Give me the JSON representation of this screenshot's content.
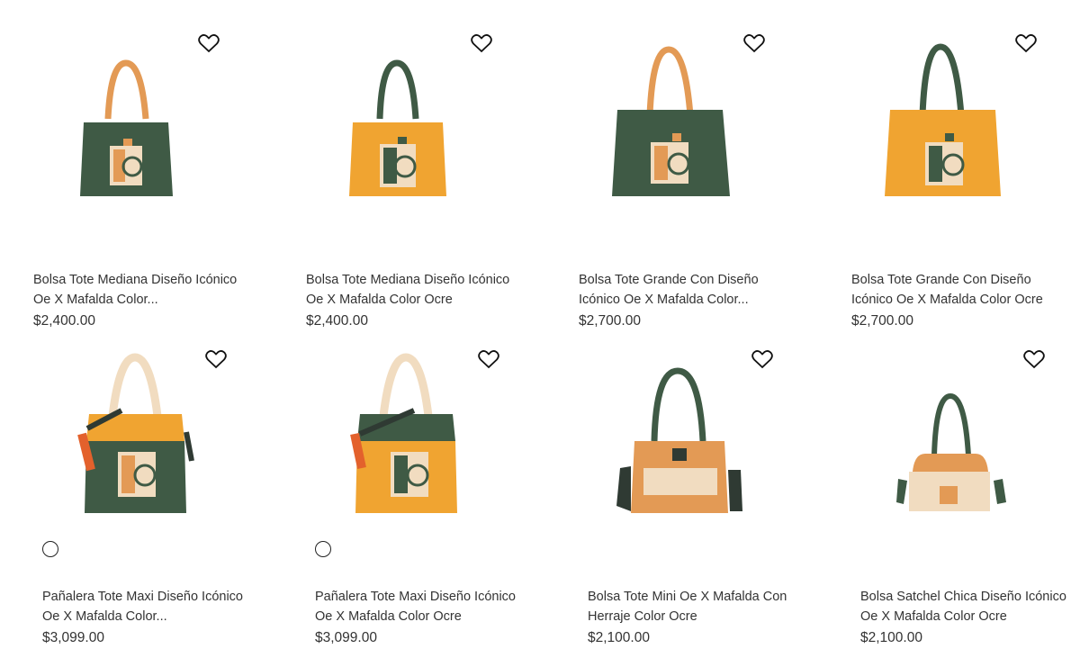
{
  "colors": {
    "green": "#3f5a45",
    "ochre": "#f0a431",
    "tan": "#e39a55",
    "cream": "#f1dcc0",
    "dark": "#2f3a33"
  },
  "products": [
    {
      "title": "Bolsa Tote Mediana Diseño Icónico Oe X Mafalda Color...",
      "price": "$2,400.00",
      "icon": "heart-icon"
    },
    {
      "title": "Bolsa Tote Mediana Diseño Icónico Oe X Mafalda Color Ocre",
      "price": "$2,400.00",
      "icon": "heart-icon"
    },
    {
      "title": "Bolsa Tote Grande Con Diseño Icónico Oe X Mafalda Color...",
      "price": "$2,700.00",
      "icon": "heart-icon"
    },
    {
      "title": "Bolsa Tote Grande Con Diseño Icónico Oe X Mafalda Color Ocre",
      "price": "$2,700.00",
      "icon": "heart-icon"
    },
    {
      "title": "Pañalera Tote Maxi Diseño Icónico Oe X Mafalda Color...",
      "price": "$3,099.00",
      "icon": "heart-icon"
    },
    {
      "title": "Pañalera Tote Maxi Diseño Icónico Oe X Mafalda Color Ocre",
      "price": "$3,099.00",
      "icon": "heart-icon"
    },
    {
      "title": "Bolsa Tote Mini Oe X Mafalda Con Herraje Color Ocre",
      "price": "$2,100.00",
      "icon": "heart-icon"
    },
    {
      "title": "Bolsa Satchel Chica Diseño Icónico Oe X Mafalda Color Ocre",
      "price": "$2,100.00",
      "icon": "heart-icon"
    }
  ]
}
